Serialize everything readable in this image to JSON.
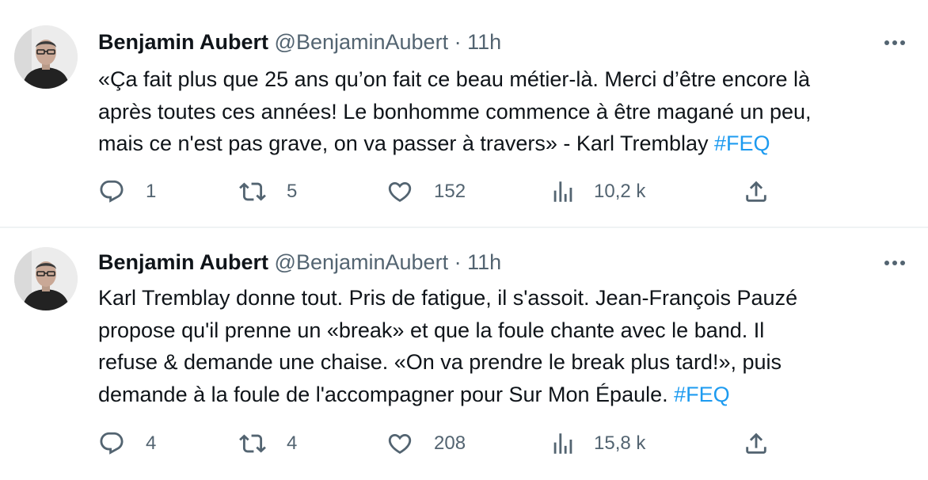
{
  "tweets": [
    {
      "author_name": "Benjamin Aubert",
      "handle": "@BenjaminAubert",
      "separator": "·",
      "time": "11h",
      "text": "«Ça fait plus que 25 ans qu’on fait ce beau métier-là. Merci d’être encore là\naprès toutes ces années! Le bonhomme commence à être magané un peu,\nmais ce n'est pas grave, on va passer à travers» - Karl Tremblay ",
      "hashtag": "#FEQ",
      "replies": "1",
      "retweets": "5",
      "likes": "152",
      "views": "10,2 k"
    },
    {
      "author_name": "Benjamin Aubert",
      "handle": "@BenjaminAubert",
      "separator": "·",
      "time": "11h",
      "text": "Karl Tremblay donne tout. Pris de fatigue, il s'assoit. Jean-François Pauzé\npropose qu'il prenne un «break» et que la foule chante avec le band. Il\nrefuse & demande une chaise. «On va prendre le break plus tard!», puis\ndemande à la foule de l'accompagner pour Sur Mon Épaule. ",
      "hashtag": "#FEQ",
      "replies": "4",
      "retweets": "4",
      "likes": "208",
      "views": "15,8 k"
    }
  ],
  "icons": {
    "reply": "reply-icon",
    "retweet": "retweet-icon",
    "like": "heart-icon",
    "views": "views-icon",
    "share": "share-icon",
    "more": "more-icon"
  },
  "colors": {
    "text": "#0f1419",
    "secondary": "#536471",
    "hashtag": "#1d9bf0",
    "divider": "#eff3f4"
  }
}
